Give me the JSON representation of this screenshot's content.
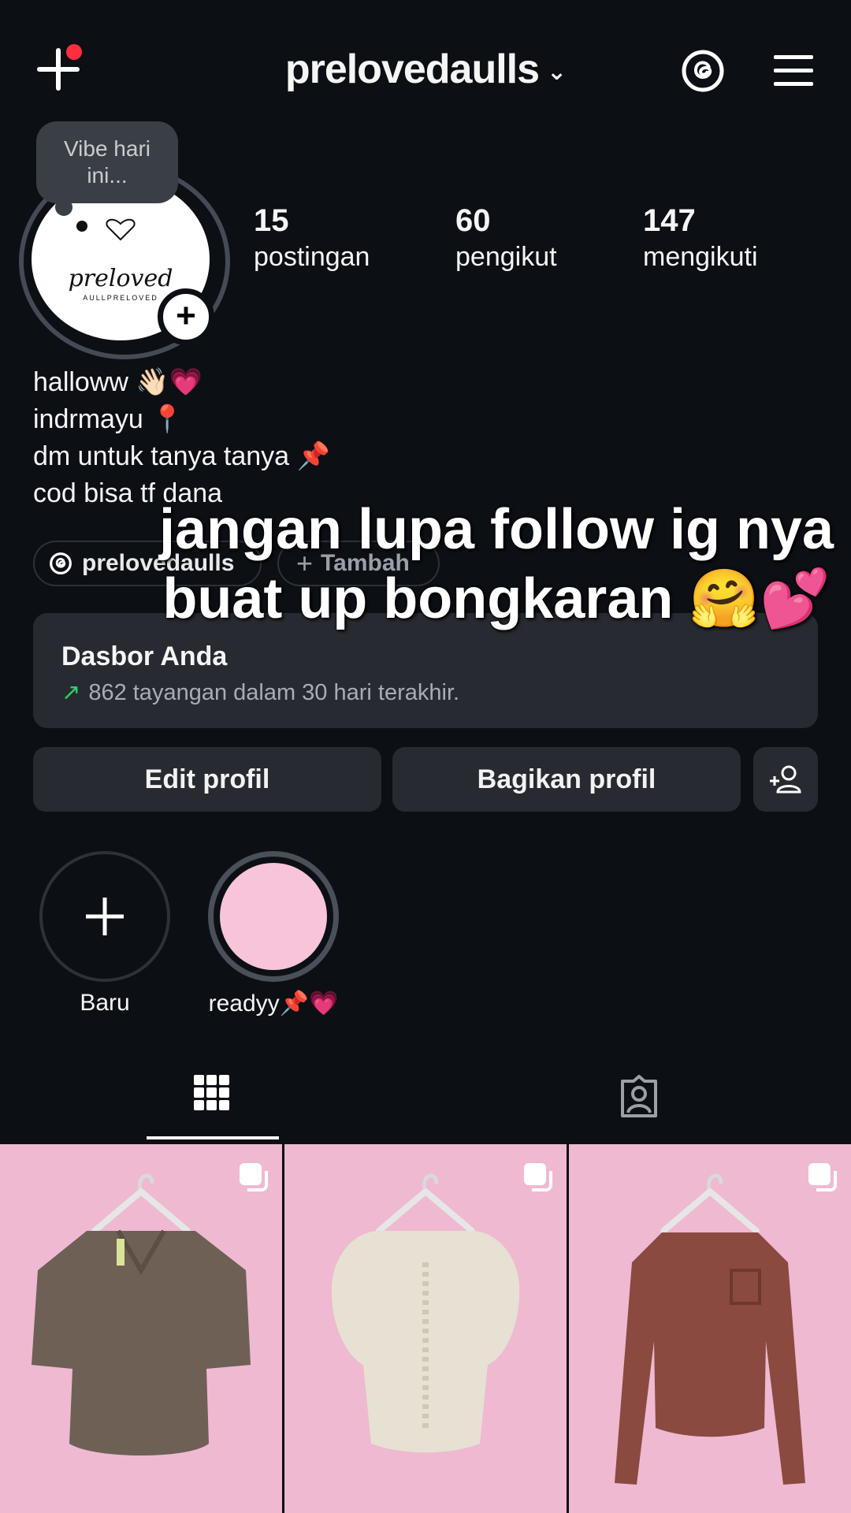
{
  "header": {
    "username": "prelovedaulls",
    "chevron": "⌄",
    "icons": {
      "create": "plus-icon",
      "threads": "threads-icon",
      "menu": "hamburger-menu-icon"
    }
  },
  "profile": {
    "note": "Vibe hari ini...",
    "avatar_logo": "preloved",
    "avatar_logo_sub": "AULLPRELOVED",
    "stats": [
      {
        "value": "15",
        "label": "postingan"
      },
      {
        "value": "60",
        "label": "pengikut"
      },
      {
        "value": "147",
        "label": "mengikuti"
      }
    ],
    "bio": [
      "halloww 👋🏻💗",
      "indrmayu 📍",
      "dm untuk tanya tanya 📌",
      "cod bisa tf dana"
    ],
    "threads_chip": "prelovedaulls",
    "add_chip": "Tambah"
  },
  "overlay": {
    "line1": "jangan lupa follow ig nya",
    "line2": "buat up bongkaran 🤗💕"
  },
  "dashboard": {
    "title": "Dasbor Anda",
    "subtitle": "862 tayangan dalam 30 hari terakhir."
  },
  "buttons": {
    "edit": "Edit profil",
    "share": "Bagikan profil"
  },
  "highlights": [
    {
      "label": "Baru"
    },
    {
      "label": "readyy📌💗"
    }
  ],
  "tabs": [
    {
      "icon": "grid-icon",
      "active": true
    },
    {
      "icon": "tagged-icon",
      "active": false
    }
  ],
  "colors": {
    "background": "#0c0f14",
    "card": "#272b31",
    "notification_dot": "#ff2d3d",
    "trend_green": "#2fd15b",
    "post_background": "#efb9d2",
    "highlight_fill": "#f7c4da"
  },
  "posts": [
    {
      "item": "brown-collared-top-icon",
      "multi": true
    },
    {
      "item": "cream-puff-sleeve-blouse-icon",
      "multi": true
    },
    {
      "item": "rust-long-sleeve-top-icon",
      "multi": true
    }
  ]
}
